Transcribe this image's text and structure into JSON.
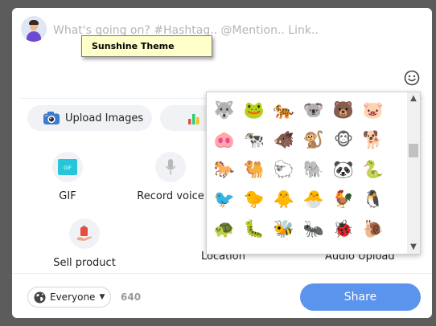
{
  "composer": {
    "placeholder": "What's going on? #Hashtag.. @Mention.. Link..",
    "tooltip": "Sunshine Theme"
  },
  "actions": {
    "upload_images": "Upload Images",
    "gif": "GIF",
    "gif_badge": "GIF",
    "record_voice": "Record voice",
    "sell_product": "Sell product",
    "location": "Location",
    "audio_upload": "Audio Upload"
  },
  "emoji_picker": {
    "emojis": [
      "🐺",
      "🐸",
      "🐅",
      "🐨",
      "🐻",
      "🐷",
      "🐽",
      "🐄",
      "🐗",
      "🐒",
      "🐵",
      "🐕",
      "🐎",
      "🐫",
      "🐑",
      "🐘",
      "🐼",
      "🐍",
      "🐦",
      "🐤",
      "🐥",
      "🐣",
      "🐓",
      "🐧",
      "🐢",
      "🐛",
      "🐝",
      "🐜",
      "🐞",
      "🐌"
    ],
    "scroll_up": "▲",
    "scroll_down": "▼"
  },
  "footer": {
    "audience": "Everyone",
    "char_count": "640",
    "share": "Share"
  },
  "colors": {
    "accent": "#5b94ec",
    "tooltip_bg": "#ffffc9",
    "chip_bg": "#f0f2f5"
  },
  "icons": [
    "emoji-smiley-icon",
    "camera-icon",
    "bar-chart-icon",
    "microphone-icon",
    "shopping-bag-icon",
    "globe-icon",
    "chevron-down-icon"
  ]
}
